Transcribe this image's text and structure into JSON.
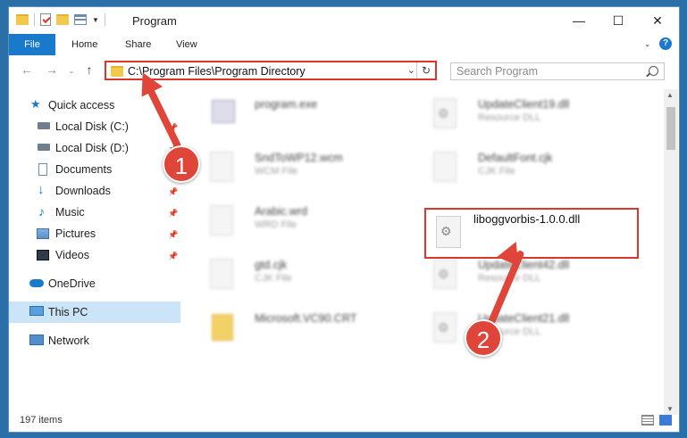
{
  "window": {
    "title": "Program",
    "controls": {
      "minimize": "—",
      "maximize": "☐",
      "close": "✕"
    }
  },
  "ribbon": {
    "tabs": [
      "File",
      "Home",
      "Share",
      "View"
    ],
    "help": "?"
  },
  "nav_buttons": {
    "back": "←",
    "forward": "→",
    "up": "↑"
  },
  "address": {
    "path": "C:\\Program Files\\Program Directory",
    "refresh": "↻",
    "dropdown": "⌄"
  },
  "search": {
    "placeholder": "Search Program"
  },
  "sidebar": {
    "items": [
      {
        "label": "Quick access",
        "icon": "star-icon"
      },
      {
        "label": "Local Disk (C:)",
        "icon": "drive-icon",
        "pinned": true
      },
      {
        "label": "Local Disk (D:)",
        "icon": "drive-icon",
        "pinned": true
      },
      {
        "label": "Documents",
        "icon": "documents-icon",
        "pinned": true
      },
      {
        "label": "Downloads",
        "icon": "download-icon",
        "pinned": true
      },
      {
        "label": "Music",
        "icon": "music-icon",
        "pinned": true
      },
      {
        "label": "Pictures",
        "icon": "pictures-icon",
        "pinned": true
      },
      {
        "label": "Videos",
        "icon": "videos-icon",
        "pinned": true
      },
      {
        "label": "OneDrive",
        "icon": "cloud-icon"
      },
      {
        "label": "This PC",
        "icon": "pc-icon",
        "selected": true
      },
      {
        "label": "Network",
        "icon": "network-icon"
      }
    ]
  },
  "files": [
    {
      "name": "program.exe",
      "type": ""
    },
    {
      "name": "UpdateClient19.dll",
      "type": "Resource DLL"
    },
    {
      "name": "SndToWP12.wcm",
      "type": "WCM File"
    },
    {
      "name": "DefaultFont.cjk",
      "type": "CJK File"
    },
    {
      "name": "Arabic.wrd",
      "type": "WRD File"
    },
    {
      "name": "gtd.cjk",
      "type": "CJK File"
    },
    {
      "name": "UpdateClient42.dll",
      "type": "Resource DLL"
    },
    {
      "name": "Microsoft.VC90.CRT",
      "type": ""
    },
    {
      "name": "UpdateClient21.dll",
      "type": "Resource DLL"
    }
  ],
  "highlighted_file": {
    "name": "liboggvorbis-1.0.0.dll"
  },
  "annotations": {
    "step1": "1",
    "step2": "2"
  },
  "status": {
    "count": "197 items"
  },
  "colors": {
    "accent": "#1979ca",
    "highlight": "#d9372b",
    "arrow": "#e0453a"
  }
}
